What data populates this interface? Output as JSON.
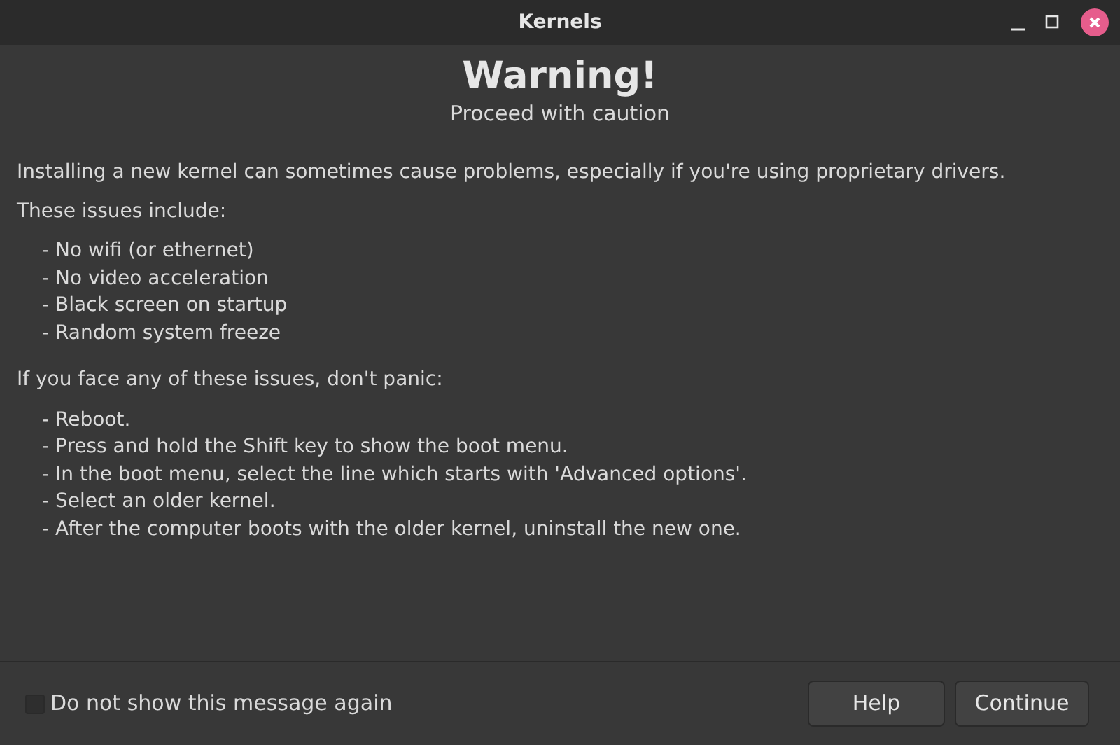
{
  "window": {
    "title": "Kernels"
  },
  "heading": "Warning!",
  "subheading": "Proceed with caution",
  "intro": "Installing a new kernel can sometimes cause problems, especially if you're using proprietary drivers.",
  "issues_title": "These issues include:",
  "issues": [
    "- No wifi (or ethernet)",
    "- No video acceleration",
    "- Black screen on startup",
    "- Random system freeze"
  ],
  "steps_title": "If you face any of these issues, don't panic:",
  "steps": [
    "- Reboot.",
    "- Press and hold the Shift key to show the boot menu.",
    "- In the boot menu, select the line which starts with 'Advanced options'.",
    "- Select an older kernel.",
    "- After the computer boots with the older kernel, uninstall the new one."
  ],
  "dont_show": {
    "label": "Do not show this message again",
    "checked": false
  },
  "buttons": [
    "Help",
    "Continue"
  ]
}
